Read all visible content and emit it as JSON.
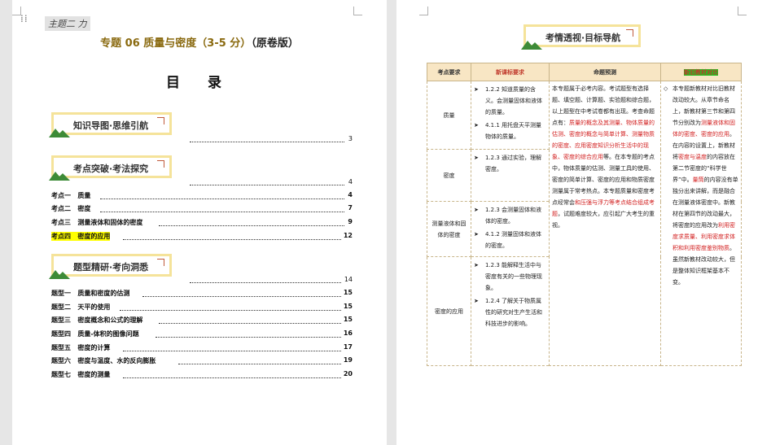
{
  "left_page": {
    "theme_tag": "主题二 力",
    "title_main": "专题 06    质量与密度（3-5 分）",
    "title_suffix": "（原卷版）",
    "toc_title": "目 录",
    "sections": [
      {
        "label": "知识导图·思维引航",
        "page": "3",
        "items": []
      },
      {
        "label": "考点突破·考法探究",
        "page": "4",
        "items": [
          {
            "tag": "考点一",
            "text": "质量",
            "page": "4",
            "highlight": false
          },
          {
            "tag": "考点二",
            "text": "密度",
            "page": "7",
            "highlight": false
          },
          {
            "tag": "考点三",
            "text": "测量液体和固体的密度",
            "page": "9",
            "highlight": false
          },
          {
            "tag": "考点四",
            "text": "密度的应用",
            "page": "12",
            "highlight": true
          }
        ]
      },
      {
        "label": "题型精研·考向洞悉",
        "page": "14",
        "items": [
          {
            "tag": "题型一",
            "text": "质量和密度的估测",
            "page": "15",
            "highlight": false
          },
          {
            "tag": "题型二",
            "text": "天平的使用",
            "page": "15",
            "highlight": false
          },
          {
            "tag": "题型三",
            "text": "密度概念和公式的理解",
            "page": "15",
            "highlight": false
          },
          {
            "tag": "题型四",
            "text": "质量-体积的图像问题",
            "page": "16",
            "highlight": false
          },
          {
            "tag": "题型五",
            "text": "密度的计算",
            "page": "17",
            "highlight": false
          },
          {
            "tag": "题型六",
            "text": "密度与温度、水的反向膨胀",
            "page": "19",
            "highlight": false
          },
          {
            "tag": "题型七",
            "text": "密度的测量",
            "page": "20",
            "highlight": false
          }
        ]
      }
    ]
  },
  "right_page": {
    "heading": "考情透视·目标导航",
    "table": {
      "headers": [
        "考点要求",
        "新课标要求",
        "命题预测",
        "新旧教材对比"
      ],
      "rows": [
        {
          "topic": "质量",
          "reqs": [
            "1.2.2 知道质量的含义。会测量固体和液体的质量。",
            "4.1.1 用托盘天平测量物体的质量。"
          ]
        },
        {
          "topic": "密度",
          "reqs": [
            "1.2.3 通过实验，理解密度。"
          ]
        },
        {
          "topic": "测量液体和固体的密度",
          "reqs": [
            "1.2.3 会测量固体和液体的密度。",
            "4.1.2 测量固体和液体的密度。"
          ]
        },
        {
          "topic": "密度的应用",
          "reqs": [
            "1.2.3 能解释生活中与密度有关的一些物理现象。",
            "1.2.4 了解关于物质属性的研究对生产生活和科技进步的影响。"
          ]
        }
      ],
      "prediction": [
        {
          "text": "本专题属于必考内容。考试题型有选择题、填空题、计算题、实验题和综合题，以上题型在中考试卷都有出现。考查命题点有：",
          "red": false
        },
        {
          "text": "质量的概念及其测量、物体质量的估测、密度的概念与简单计算、测量物质的密度、应用密度知识分析生活中的现象、密度的综合应用",
          "red": true
        },
        {
          "text": "等。在本专题的考点中，物体质量的估测、测量工具的使用、密度的简单计算、密度的应用和物质密度测量属于常考热点。本专题质量和密度考点经常会",
          "red": false
        },
        {
          "text": "和压强与浮力等考点结合组成考题",
          "red": true
        },
        {
          "text": "，试题难度较大，应引起广大考生的重视。",
          "red": false
        }
      ],
      "comparison": [
        {
          "text": "本专题新教材对比旧教材改动较大。从章节命名上，新教材第三节和第四节分别改为",
          "red": false
        },
        {
          "text": "测量液体和固体的密度、密度的应用",
          "red": true
        },
        {
          "text": "。在内容的设置上，新教材将",
          "red": false
        },
        {
          "text": "密度与温度",
          "red": true
        },
        {
          "text": "的内容放在第二节密度的“科学世界”中。",
          "red": false
        },
        {
          "text": "量筒",
          "red": true
        },
        {
          "text": "的内容没有单独分出来讲解，而是融合在测量液体密度中。新教材在第四节的改动最大，将密度的应用改为",
          "red": false
        },
        {
          "text": "利用密度求质量、利用密度求体积和利用密度鉴别物质",
          "red": true
        },
        {
          "text": "。虽然新教材改动较大，但是整体知识框架基本不变。",
          "red": false
        }
      ]
    }
  },
  "colors": {
    "section_border": "#f5e39a",
    "title_gold": "#8a6a10",
    "header_bg": "#f8e6c4",
    "header_text": "#c0392b",
    "emphasis_red": "#d21f1f",
    "toc_highlight": "#ffff00",
    "header_highlight": "#22c122"
  },
  "icons": [
    "drag-handle-icon",
    "mountain-icon",
    "corner-marker-icon"
  ]
}
